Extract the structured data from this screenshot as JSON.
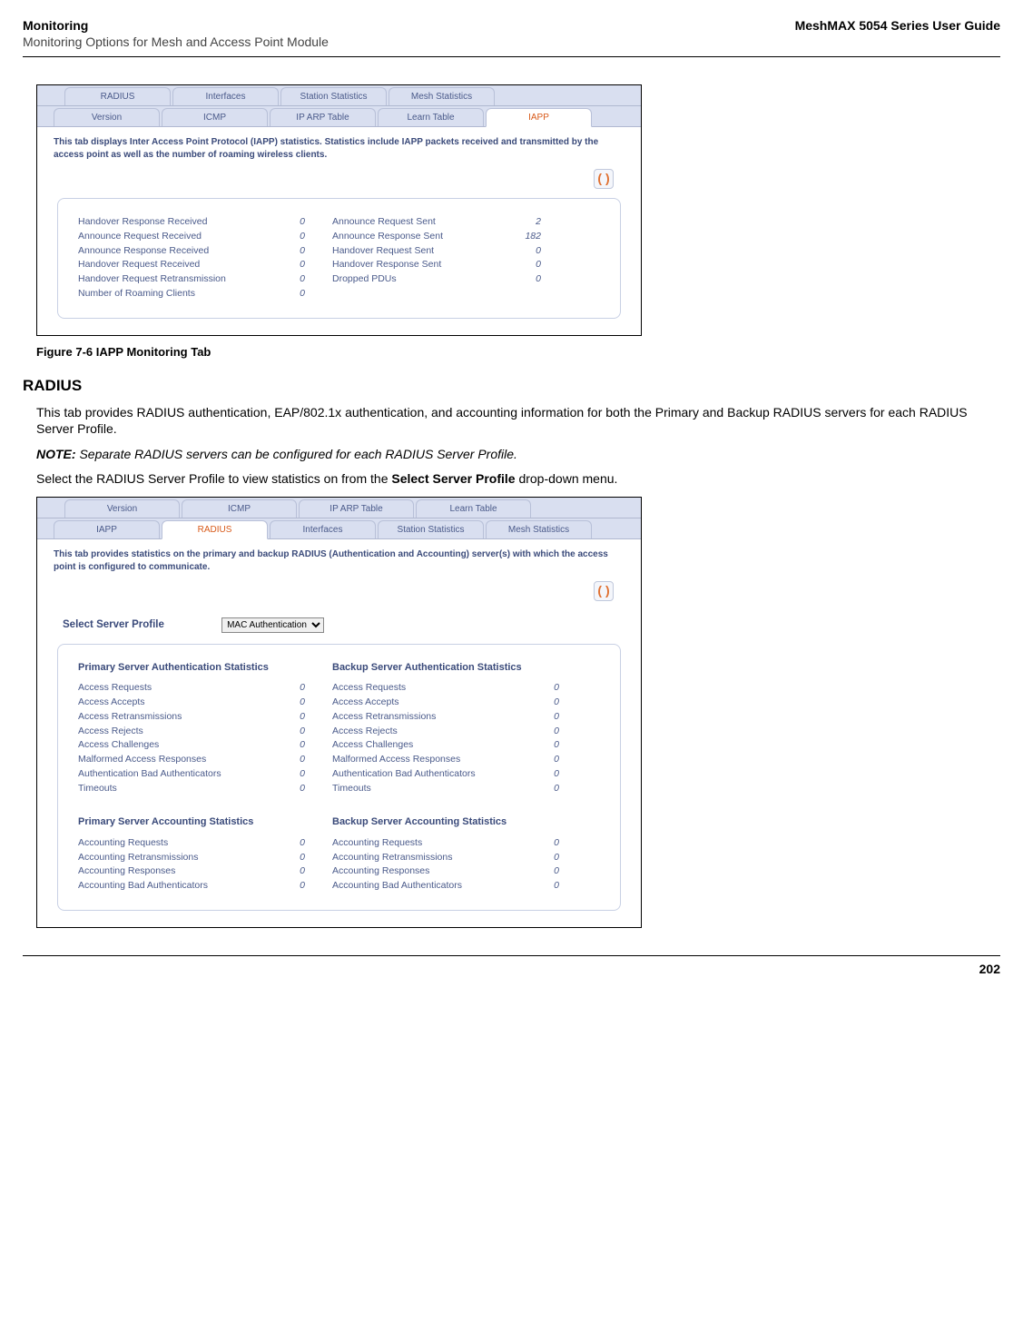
{
  "header": {
    "left_title": "Monitoring",
    "left_sub": "Monitoring Options for Mesh and Access Point Module",
    "right": "MeshMAX 5054 Series User Guide"
  },
  "footer": {
    "page": "202"
  },
  "fig1": {
    "caption": "Figure 7-6 IAPP Monitoring Tab",
    "tabs_top": [
      "RADIUS",
      "Interfaces",
      "Station Statistics",
      "Mesh Statistics"
    ],
    "tabs_bottom": [
      "Version",
      "ICMP",
      "IP ARP Table",
      "Learn Table",
      "IAPP"
    ],
    "active_tab": "IAPP",
    "desc": "This tab displays Inter Access Point Protocol (IAPP) statistics. Statistics include IAPP packets received and transmitted by the access point as well as the number of roaming wireless clients.",
    "left_labels": [
      "Handover Response Received",
      "Announce Request Received",
      "Announce Response Received",
      "Handover Request Received",
      "Handover Request Retransmission",
      "Number of Roaming Clients"
    ],
    "left_vals": [
      "0",
      "0",
      "0",
      "0",
      "0",
      "0"
    ],
    "right_labels": [
      "Announce Request Sent",
      "Announce Response Sent",
      "Handover Request Sent",
      "Handover Response Sent",
      "Dropped PDUs"
    ],
    "right_vals": [
      "2",
      "182",
      "0",
      "0",
      "0"
    ]
  },
  "radius": {
    "heading": "RADIUS",
    "para": "This tab provides RADIUS authentication, EAP/802.1x authentication, and accounting information for both the Primary and Backup RADIUS servers for each RADIUS Server Profile.",
    "note_label": "NOTE:",
    "note_text": "Separate RADIUS servers can be configured for each RADIUS Server Profile.",
    "para2_a": "Select the RADIUS Server Profile to view statistics on from the ",
    "para2_b": "Select Server Profile",
    "para2_c": " drop-down menu."
  },
  "fig2": {
    "tabs_top": [
      "Version",
      "ICMP",
      "IP ARP Table",
      "Learn Table"
    ],
    "tabs_bottom": [
      "IAPP",
      "RADIUS",
      "Interfaces",
      "Station Statistics",
      "Mesh Statistics"
    ],
    "active_tab": "RADIUS",
    "desc": "This tab provides statistics on the primary and backup RADIUS (Authentication and Accounting) server(s) with which the access point is configured to communicate.",
    "select_label": "Select Server Profile",
    "select_value": "MAC Authentication",
    "auth_labels": [
      "Access Requests",
      "Access Accepts",
      "Access Retransmissions",
      "Access Rejects",
      "Access Challenges",
      "Malformed Access Responses",
      "Authentication Bad Authenticators",
      "Timeouts"
    ],
    "auth_vals": [
      "0",
      "0",
      "0",
      "0",
      "0",
      "0",
      "0",
      "0"
    ],
    "acct_labels": [
      "Accounting Requests",
      "Accounting Retransmissions",
      "Accounting Responses",
      "Accounting Bad Authenticators"
    ],
    "acct_vals": [
      "0",
      "0",
      "0",
      "0"
    ],
    "head_pri_auth": "Primary Server Authentication Statistics",
    "head_bak_auth": "Backup Server Authentication Statistics",
    "head_pri_acct": "Primary Server Accounting Statistics",
    "head_bak_acct": "Backup Server Accounting Statistics"
  }
}
